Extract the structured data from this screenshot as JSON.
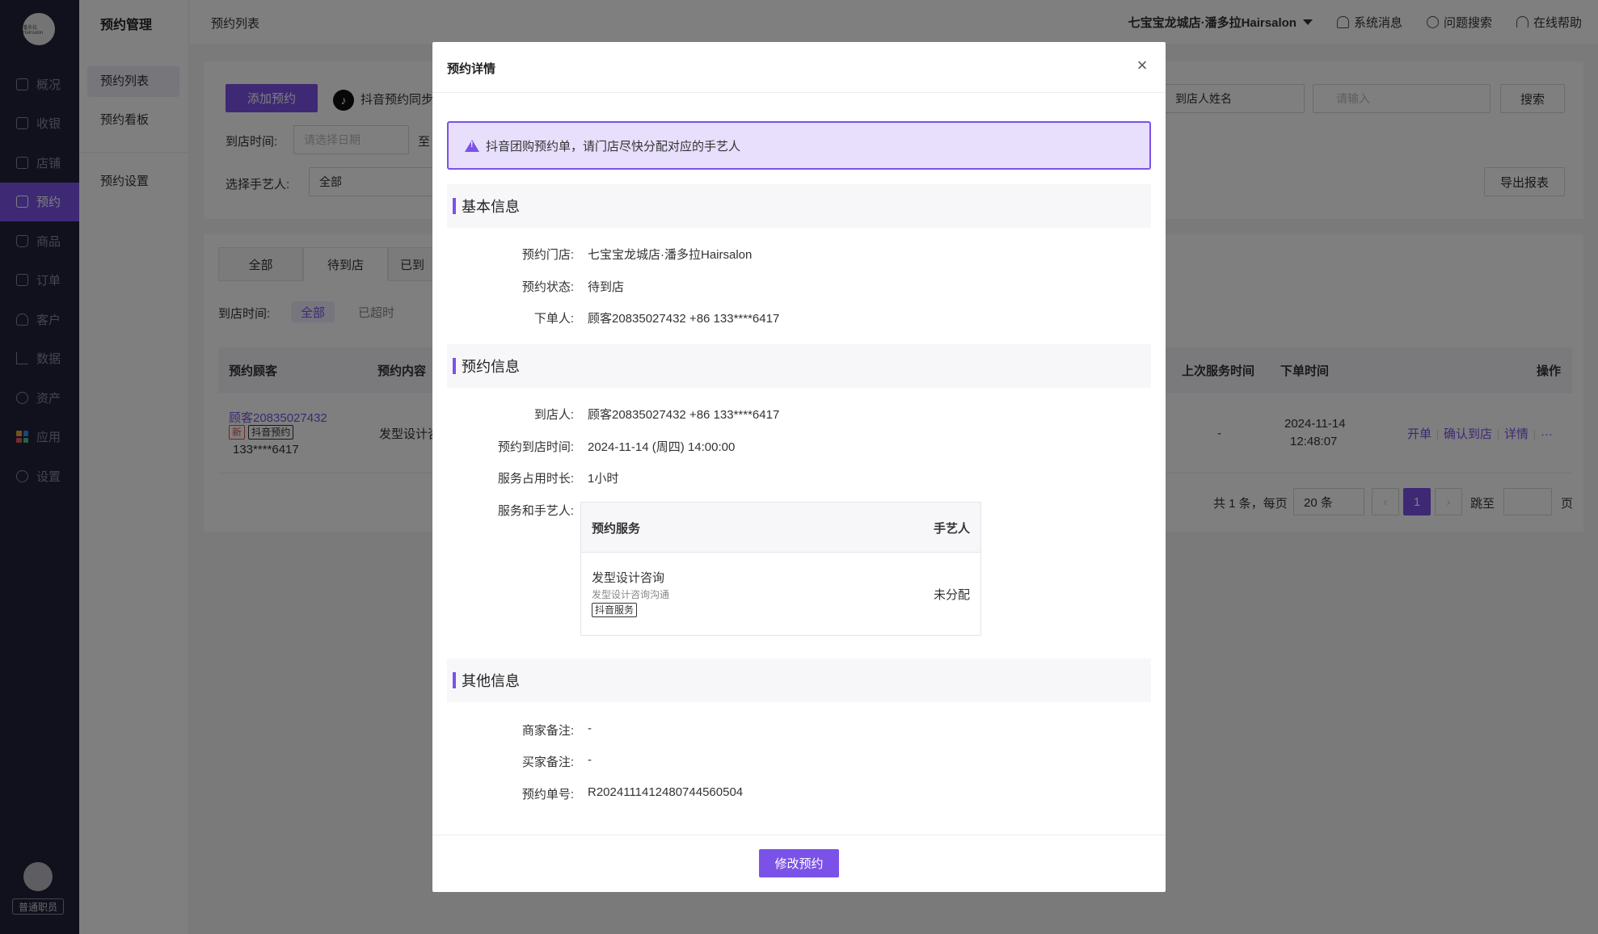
{
  "sidebar": {
    "logo_text": "潘多拉Hairsalon",
    "items": [
      {
        "label": "概况"
      },
      {
        "label": "收银"
      },
      {
        "label": "店铺"
      },
      {
        "label": "预约"
      },
      {
        "label": "商品"
      },
      {
        "label": "订单"
      },
      {
        "label": "客户"
      },
      {
        "label": "数据"
      },
      {
        "label": "资产"
      },
      {
        "label": "应用"
      },
      {
        "label": "设置"
      }
    ],
    "role": "普通职员"
  },
  "subnav": {
    "title": "预约管理",
    "items": [
      "预约列表",
      "预约看板",
      "预约设置"
    ]
  },
  "topbar": {
    "breadcrumb": "预约列表",
    "store": "七宝宝龙城店·潘多拉Hairsalon",
    "messages": "系统消息",
    "search": "问题搜索",
    "help": "在线帮助"
  },
  "filters": {
    "add_button": "添加预约",
    "douyin_sync": "抖音预约同步",
    "arrive_time_label": "到店时间:",
    "date_placeholder": "请选择日期",
    "to": "至",
    "artist_label": "选择手艺人:",
    "artist_value": "全部",
    "search_field": "到店人姓名",
    "search_placeholder": "请输入",
    "search_button": "搜索",
    "export_button": "导出报表"
  },
  "tabs": [
    "全部",
    "待到店",
    "已到"
  ],
  "time_filter": {
    "label": "到店时间:",
    "options": [
      "全部",
      "已超时"
    ]
  },
  "table": {
    "headers": [
      "预约顾客",
      "预约内容",
      "上次服务时间",
      "下单时间",
      "操作"
    ],
    "row": {
      "customer": "顾客20835027432",
      "tag_new": "新",
      "tag_douyin": "抖音预约",
      "phone": "133****6417",
      "content": "发型设计咨",
      "last_service": "-",
      "order_date": "2024-11-14",
      "order_time": "12:48:07",
      "ops": [
        "开单",
        "确认到店",
        "详情"
      ],
      "more": "···"
    }
  },
  "pager": {
    "total": "共 1 条，每页",
    "page_size": "20 条",
    "current": "1",
    "jump": "跳至",
    "page_unit": "页"
  },
  "modal": {
    "title": "预约详情",
    "close": "×",
    "alert": "抖音团购预约单，请门店尽快分配对应的手艺人",
    "basic": {
      "title": "基本信息",
      "store_k": "预约门店:",
      "store_v": "七宝宝龙城店·潘多拉Hairsalon",
      "status_k": "预约状态:",
      "status_v": "待到店",
      "buyer_k": "下单人:",
      "buyer_v": "顾客20835027432 +86 133****6417"
    },
    "booking": {
      "title": "预约信息",
      "visitor_k": "到店人:",
      "visitor_v": "顾客20835027432  +86  133****6417",
      "time_k": "预约到店时间:",
      "time_v": "2024-11-14 (周四) 14:00:00",
      "duration_k": "服务占用时长:",
      "duration_v": "1小时",
      "svc_k": "服务和手艺人:",
      "svc_headers": [
        "预约服务",
        "手艺人"
      ],
      "svc_name": "发型设计咨询",
      "svc_desc": "发型设计咨询沟通",
      "svc_tag": "抖音服务",
      "svc_artist": "未分配"
    },
    "other": {
      "title": "其他信息",
      "merchant_k": "商家备注:",
      "merchant_v": "-",
      "buyer_note_k": "买家备注:",
      "buyer_note_v": "-",
      "order_k": "预约单号:",
      "order_v": "R2024111412480744560504"
    },
    "edit_button": "修改预约"
  }
}
